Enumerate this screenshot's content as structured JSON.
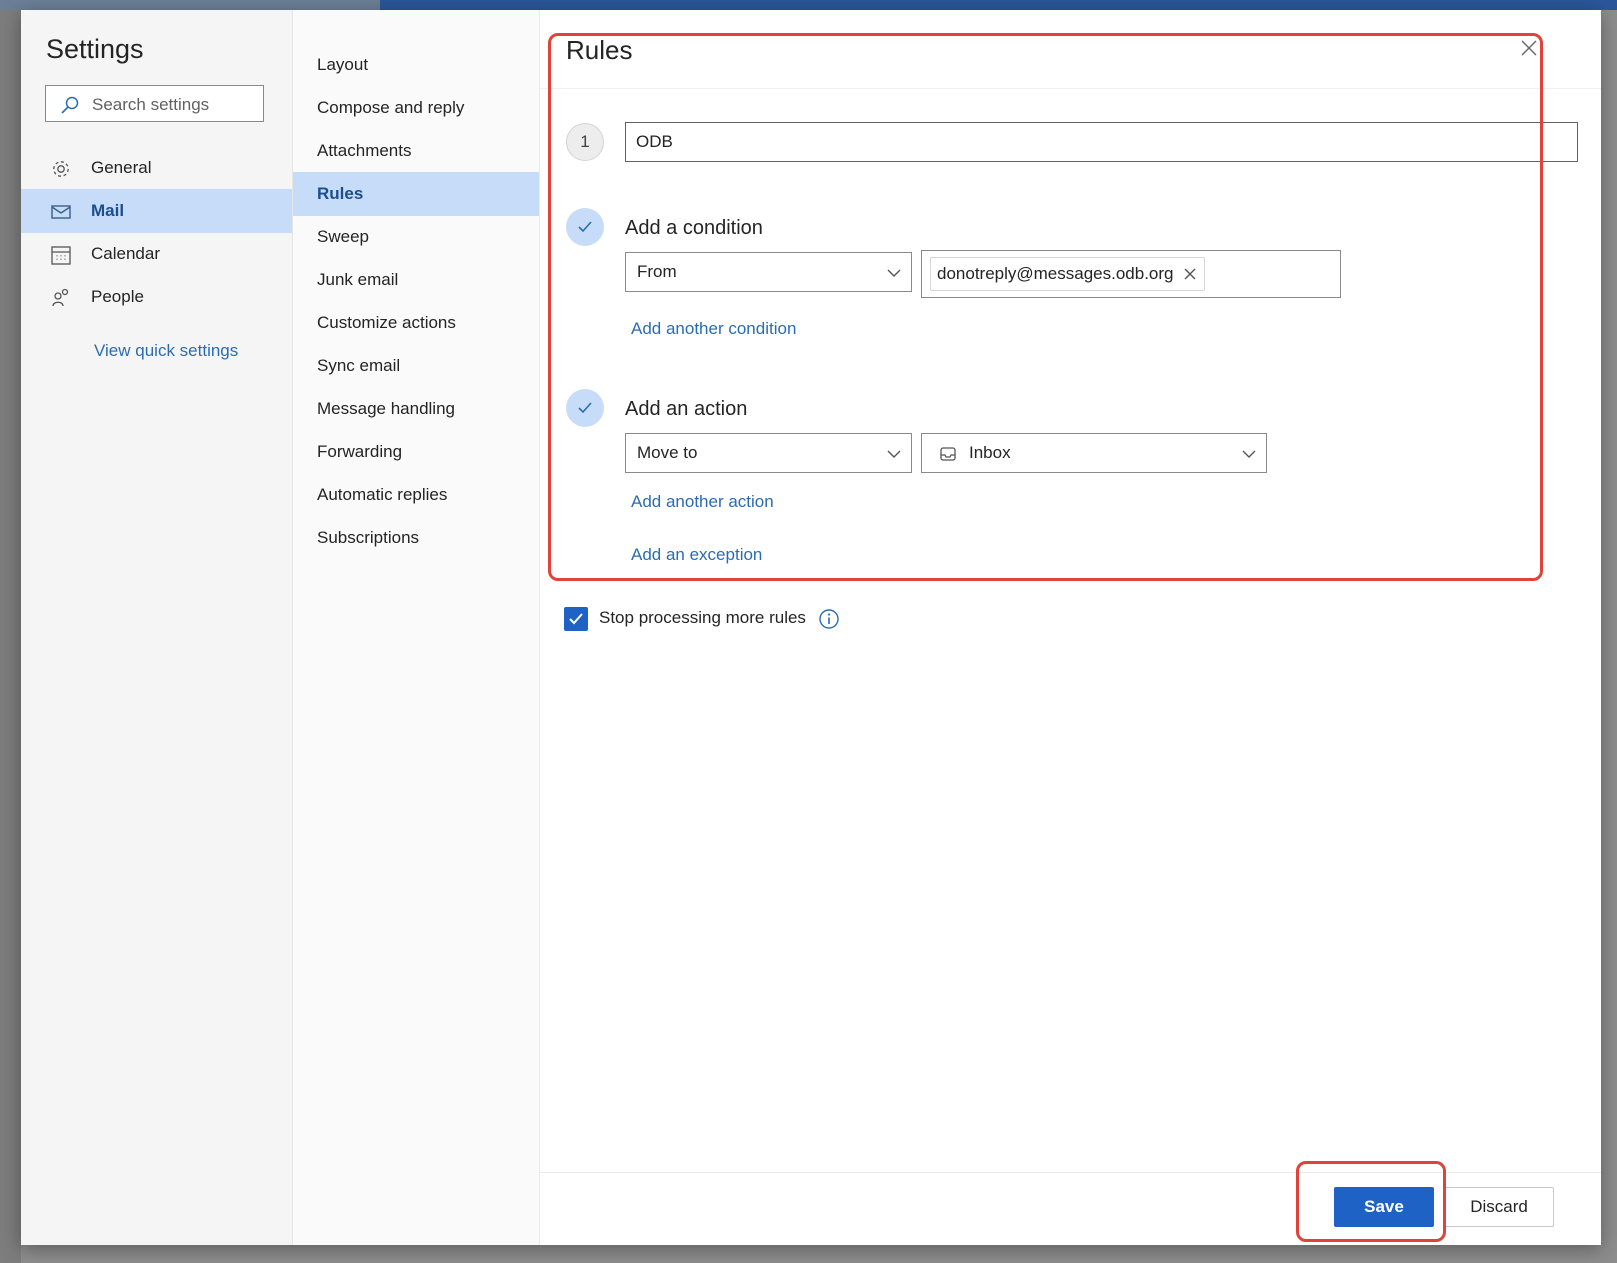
{
  "settings": {
    "title": "Settings",
    "search_placeholder": "Search settings",
    "categories": [
      {
        "label": "General",
        "icon": "gear-icon"
      },
      {
        "label": "Mail",
        "icon": "mail-icon",
        "selected": true
      },
      {
        "label": "Calendar",
        "icon": "calendar-icon"
      },
      {
        "label": "People",
        "icon": "people-icon"
      }
    ],
    "quick_settings_link": "View quick settings"
  },
  "mail_nav": {
    "items": [
      {
        "label": "Layout"
      },
      {
        "label": "Compose and reply"
      },
      {
        "label": "Attachments"
      },
      {
        "label": "Rules",
        "selected": true
      },
      {
        "label": "Sweep"
      },
      {
        "label": "Junk email"
      },
      {
        "label": "Customize actions"
      },
      {
        "label": "Sync email"
      },
      {
        "label": "Message handling"
      },
      {
        "label": "Forwarding"
      },
      {
        "label": "Automatic replies"
      },
      {
        "label": "Subscriptions"
      }
    ]
  },
  "rules": {
    "title": "Rules",
    "step_number": "1",
    "rule_name": "ODB",
    "condition": {
      "heading": "Add a condition",
      "field": "From",
      "recipient": "donotreply@messages.odb.org",
      "add_link": "Add another condition"
    },
    "action": {
      "heading": "Add an action",
      "type": "Move to",
      "folder": "Inbox",
      "add_link": "Add another action"
    },
    "exception_link": "Add an exception",
    "stop_processing": {
      "label": "Stop processing more rules",
      "checked": true
    },
    "save_label": "Save",
    "discard_label": "Discard"
  },
  "colors": {
    "accent": "#1f62c6",
    "selected_bg": "#c7dcf8",
    "annotation": "#e0433a"
  }
}
